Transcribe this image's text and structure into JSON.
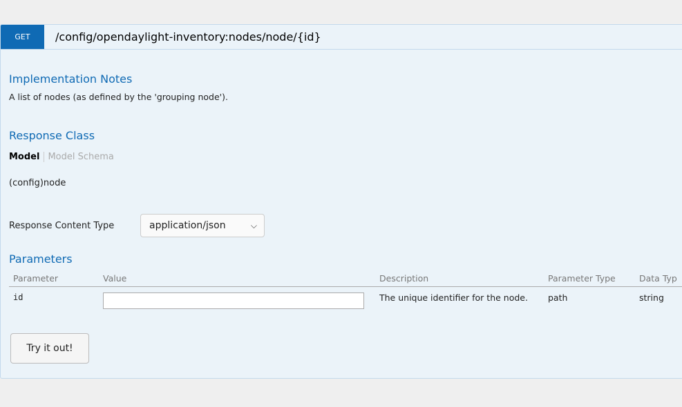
{
  "operation": {
    "method": "GET",
    "path": "/config/opendaylight-inventory:nodes/node/{id}"
  },
  "implementation_notes": {
    "title": "Implementation Notes",
    "text": "A list of nodes (as defined by the 'grouping node')."
  },
  "response_class": {
    "title": "Response Class",
    "tabs": [
      "Model",
      "Model Schema"
    ],
    "model": "(config)node"
  },
  "response_content_type": {
    "label": "Response Content Type",
    "selected": "application/json"
  },
  "parameters": {
    "title": "Parameters",
    "headers": [
      "Parameter",
      "Value",
      "Description",
      "Parameter Type",
      "Data Typ"
    ],
    "rows": [
      {
        "name": "id",
        "value": "",
        "description": "The unique identifier for the node.",
        "param_type": "path",
        "data_type": "string"
      }
    ]
  },
  "try_button": "Try it out!"
}
